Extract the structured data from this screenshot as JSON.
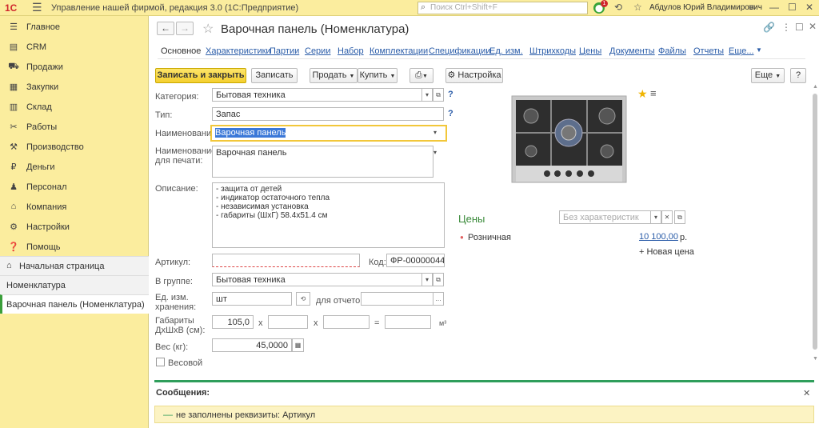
{
  "app": {
    "logo": "1С",
    "window_title": "Управление нашей фирмой, редакция 3.0  (1С:Предприятие)",
    "search_placeholder": "Поиск Ctrl+Shift+F",
    "notification_count": "1",
    "user_name": "Абдулов Юрий Владимирович"
  },
  "sidebar": {
    "items": [
      {
        "label": "Главное",
        "icon": "menu-icon"
      },
      {
        "label": "CRM",
        "icon": "crm-icon"
      },
      {
        "label": "Продажи",
        "icon": "cart-icon"
      },
      {
        "label": "Закупки",
        "icon": "purchases-icon"
      },
      {
        "label": "Склад",
        "icon": "warehouse-icon"
      },
      {
        "label": "Работы",
        "icon": "tools-icon"
      },
      {
        "label": "Производство",
        "icon": "factory-icon"
      },
      {
        "label": "Деньги",
        "icon": "money-icon"
      },
      {
        "label": "Персонал",
        "icon": "person-icon"
      },
      {
        "label": "Компания",
        "icon": "company-icon"
      },
      {
        "label": "Настройки",
        "icon": "settings-icon"
      },
      {
        "label": "Помощь",
        "icon": "help-icon"
      }
    ],
    "home": "Начальная страница",
    "open_windows": [
      "Номенклатура",
      "Варочная панель (Номенклатура)"
    ]
  },
  "form": {
    "title": "Варочная панель (Номенклатура)",
    "tabs": [
      "Основное",
      "Характеристики",
      "Партии",
      "Серии",
      "Набор",
      "Комплектации",
      "Спецификации",
      "Ед. изм.",
      "Штрихкоды",
      "Цены",
      "Документы",
      "Файлы",
      "Отчеты",
      "Еще..."
    ],
    "toolbar": {
      "save_close": "Записать и закрыть",
      "save": "Записать",
      "sell": "Продать",
      "buy": "Купить",
      "settings": "Настройка",
      "more": "Еще",
      "help": "?"
    },
    "fields": {
      "category_label": "Категория:",
      "category_value": "Бытовая техника",
      "type_label": "Тип:",
      "type_value": "Запас",
      "name_label": "Наименование:",
      "name_value": "Варочная панель",
      "print_name_label": "Наименование для печати:",
      "print_name_value": "Варочная панель",
      "description_label": "Описание:",
      "description_lines": [
        "- защита от детей",
        "- индикатор остаточного тепла",
        "- независимая установка",
        "- габариты (ШхГ) 58.4х51.4 см"
      ],
      "article_label": "Артикул:",
      "article_value": "",
      "code_label": "Код:",
      "code_value": "ФР-00000044",
      "group_label": "В группе:",
      "group_value": "Бытовая техника",
      "unit_label": "Ед. изм. хранения:",
      "unit_value": "шт",
      "report_unit_label": "для отчетов:",
      "report_unit_value": "",
      "dims_label": "Габариты ДхШхВ (см):",
      "dim_l": "105,0",
      "dim_x1": "x",
      "dim_x2": "x",
      "dim_eq": "=",
      "dim_unit": "м³",
      "weight_label": "Вес (кг):",
      "weight_value": "45,0000",
      "weighted_label": "Весовой"
    },
    "prices": {
      "title": "Цены",
      "char_placeholder": "Без характеристик",
      "kind": "Розничная",
      "amount": "10 100,00",
      "currency": "р.",
      "new_price": "+ Новая цена"
    },
    "messages": {
      "title": "Сообщения:",
      "text": "не заполнены реквизиты: Артикул"
    }
  }
}
